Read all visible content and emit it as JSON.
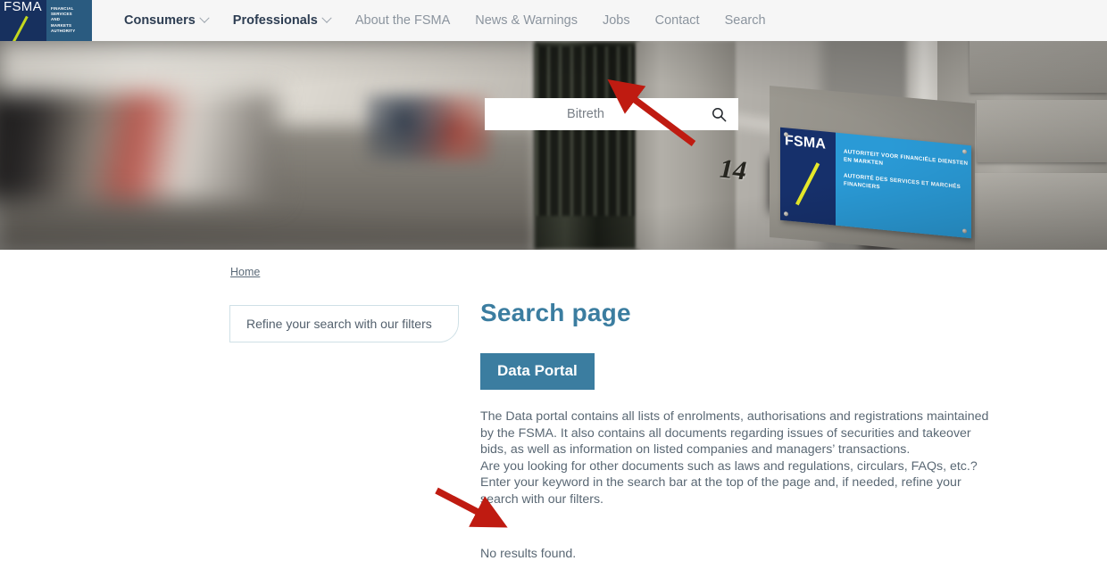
{
  "header": {
    "logo": {
      "abbr": "FSMA",
      "words": [
        "FINANCIAL",
        "SERVICES",
        "AND",
        "MARKETS",
        "AUTHORITY"
      ]
    },
    "nav": [
      {
        "label": "Consumers",
        "strong": true,
        "caret": true
      },
      {
        "label": "Professionals",
        "strong": true,
        "caret": true
      },
      {
        "label": "About the FSMA",
        "strong": false,
        "caret": false
      },
      {
        "label": "News & Warnings",
        "strong": false,
        "caret": false
      },
      {
        "label": "Jobs",
        "strong": false,
        "caret": false
      },
      {
        "label": "Contact",
        "strong": false,
        "caret": false
      },
      {
        "label": "Search",
        "strong": false,
        "caret": false
      }
    ]
  },
  "hero": {
    "search": {
      "value": "Bitreth",
      "placeholder": "Bitreth",
      "icon": "search-icon"
    },
    "plaque": {
      "abbr": "FSMA",
      "line_nl": "AUTORITEIT VOOR FINANCIËLE DIENSTEN EN MARKTEN",
      "line_fr": "AUTORITÉ DES SERVICES ET MARCHÉS FINANCIERS"
    },
    "house_number": "14"
  },
  "content": {
    "breadcrumb": "Home",
    "filters_label": "Refine your search with our filters",
    "page_title": "Search page",
    "tab_label": "Data Portal",
    "paragraph_1": "The Data portal contains all lists of enrolments, authorisations and registrations maintained by the FSMA. It also contains all documents regarding issues of securities and takeover bids, as well as information on listed companies and managers’ transactions.",
    "paragraph_2": "Are you looking for other documents such as laws and regulations, circulars, FAQs, etc.? Enter your keyword in the search bar at the top of the page and, if needed, refine your search with our filters.",
    "no_results": "No results found."
  },
  "annotations": {
    "arrow_color": "#bf1b11",
    "arrow_search_target": "search-input",
    "arrow_results_target": "no-results-text"
  },
  "colors": {
    "brand_navy": "#17305e",
    "brand_blue": "#2a5b80",
    "accent_steel": "#3b7da0",
    "plaque_cyan": "#2a9ad6",
    "logo_slash": "#c4d81e",
    "arrow_red": "#bf1b11"
  }
}
